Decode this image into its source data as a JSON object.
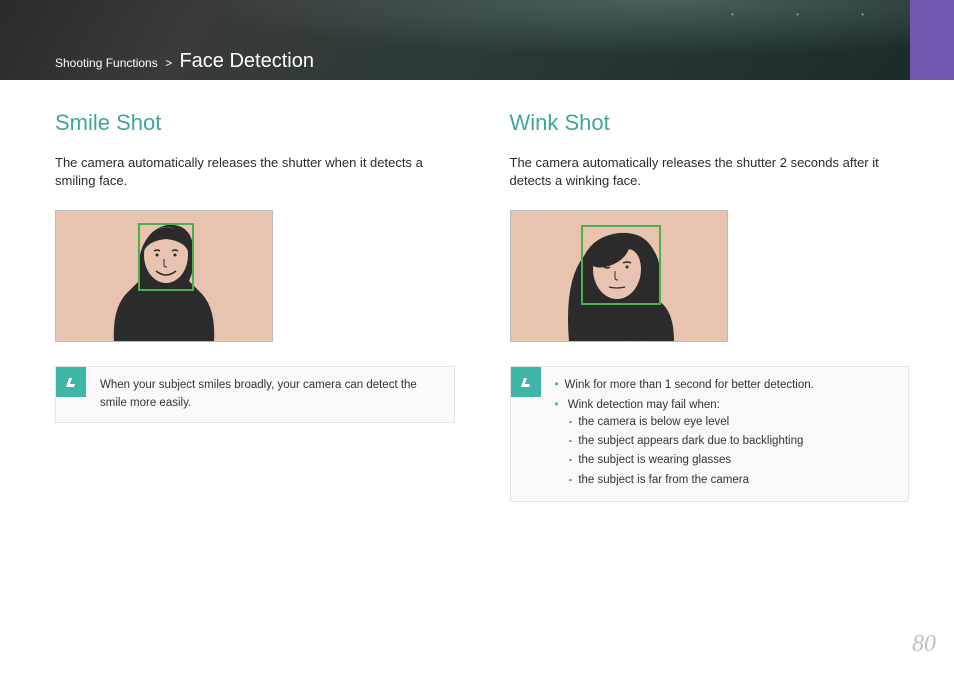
{
  "header": {
    "breadcrumb_category": "Shooting Functions",
    "chevron": ">",
    "page_title": "Face Detection"
  },
  "left": {
    "heading": "Smile Shot",
    "body": "The camera automatically releases the shutter when it detects a smiling face.",
    "note": "When your subject smiles broadly, your camera can detect the smile more easily."
  },
  "right": {
    "heading": "Wink Shot",
    "body": "The camera automatically releases the shutter 2 seconds after it detects a winking face.",
    "note_items": {
      "b1": "Wink for more than 1 second for better detection.",
      "b2": "Wink detection may fail when:",
      "s1": "the camera is below eye level",
      "s2": "the subject appears dark due to backlighting",
      "s3": "the subject is wearing glasses",
      "s4": "the subject is far from the camera"
    }
  },
  "page_number": "80"
}
